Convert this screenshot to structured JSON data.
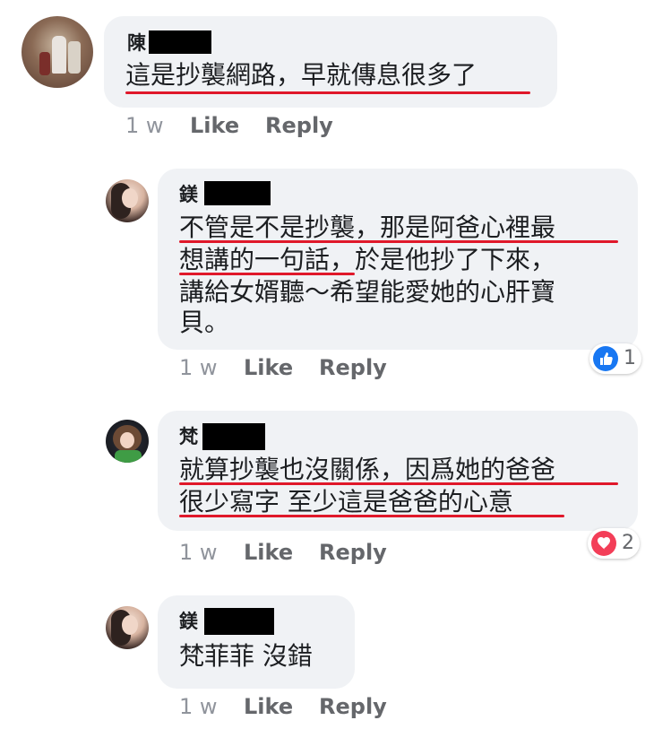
{
  "comments": [
    {
      "name": "陳",
      "lines": [
        "這是抄襲網路，早就傳息很多了"
      ],
      "time": "1 w",
      "like": "Like",
      "reply": "Reply"
    },
    {
      "name": "鎂",
      "lines": [
        "不管是不是抄襲，那是阿爸心裡最",
        "想講的一句話，於是他抄了下來，",
        "講給女婿聽～希望能愛她的心肝寶",
        "貝。"
      ],
      "time": "1 w",
      "like": "Like",
      "reply": "Reply",
      "reaction": {
        "icon": "thumbs-up-icon",
        "count": "1",
        "color": "#1877f2"
      }
    },
    {
      "name": "梵",
      "lines": [
        "就算抄襲也沒關係，因爲她的爸爸",
        "很少寫字 至少這是爸爸的心意"
      ],
      "time": "1 w",
      "like": "Like",
      "reply": "Reply",
      "reaction": {
        "icon": "heart-icon",
        "count": "2",
        "color": "#f33e58"
      }
    },
    {
      "name": "鎂",
      "lines": [
        "梵菲菲 沒錯"
      ],
      "time": "1 w",
      "like": "Like",
      "reply": "Reply"
    }
  ],
  "colors": {
    "underline": "#e0182a",
    "bubble": "#f0f2f5",
    "redaction": "#000000"
  }
}
